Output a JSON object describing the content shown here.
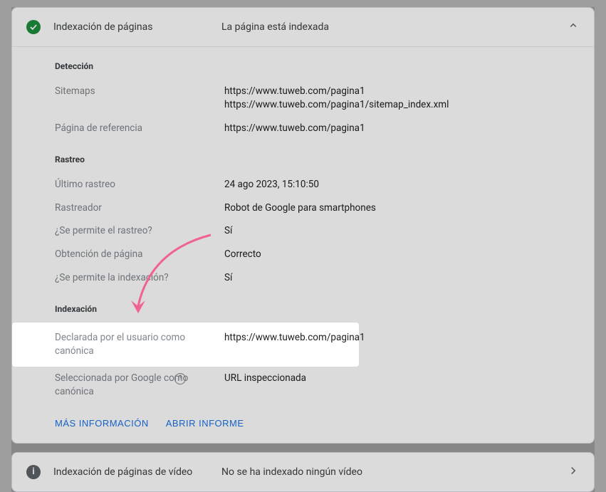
{
  "panel1": {
    "title": "Indexación de páginas",
    "status": "La página está indexada",
    "deteccion": {
      "title": "Detección",
      "sitemaps": {
        "label": "Sitemaps",
        "value1": "https://www.tuweb.com/pagina1",
        "value2": "https://www.tuweb.com/pagina1/sitemap_index.xml"
      },
      "referencia": {
        "label": "Página de referencia",
        "value": "https://www.tuweb.com/pagina1"
      }
    },
    "rastreo": {
      "title": "Rastreo",
      "ultimo": {
        "label": "Último rastreo",
        "value": "24 ago 2023, 15:10:50"
      },
      "rastreador": {
        "label": "Rastreador",
        "value": "Robot de Google para smartphones"
      },
      "permite_rastreo": {
        "label": "¿Se permite el rastreo?",
        "value": "Sí"
      },
      "obtencion": {
        "label": "Obtención de página",
        "value": "Correcto"
      },
      "permite_indexacion": {
        "label": "¿Se permite la indexación?",
        "value": "Sí"
      }
    },
    "indexacion": {
      "title": "Indexación",
      "declarada": {
        "label": "Declarada por el usuario como canónica",
        "value": "https://www.tuweb.com/pagina1"
      },
      "seleccionada": {
        "label": "Seleccionada por Google como canónica",
        "value": "URL inspeccionada"
      }
    },
    "actions": {
      "mas_info": "MÁS INFORMACIÓN",
      "abrir": "ABRIR INFORME"
    }
  },
  "panel2": {
    "title": "Indexación de páginas de vídeo",
    "status": "No se ha indexado ningún vídeo"
  },
  "colors": {
    "annotation": "#f06292"
  }
}
